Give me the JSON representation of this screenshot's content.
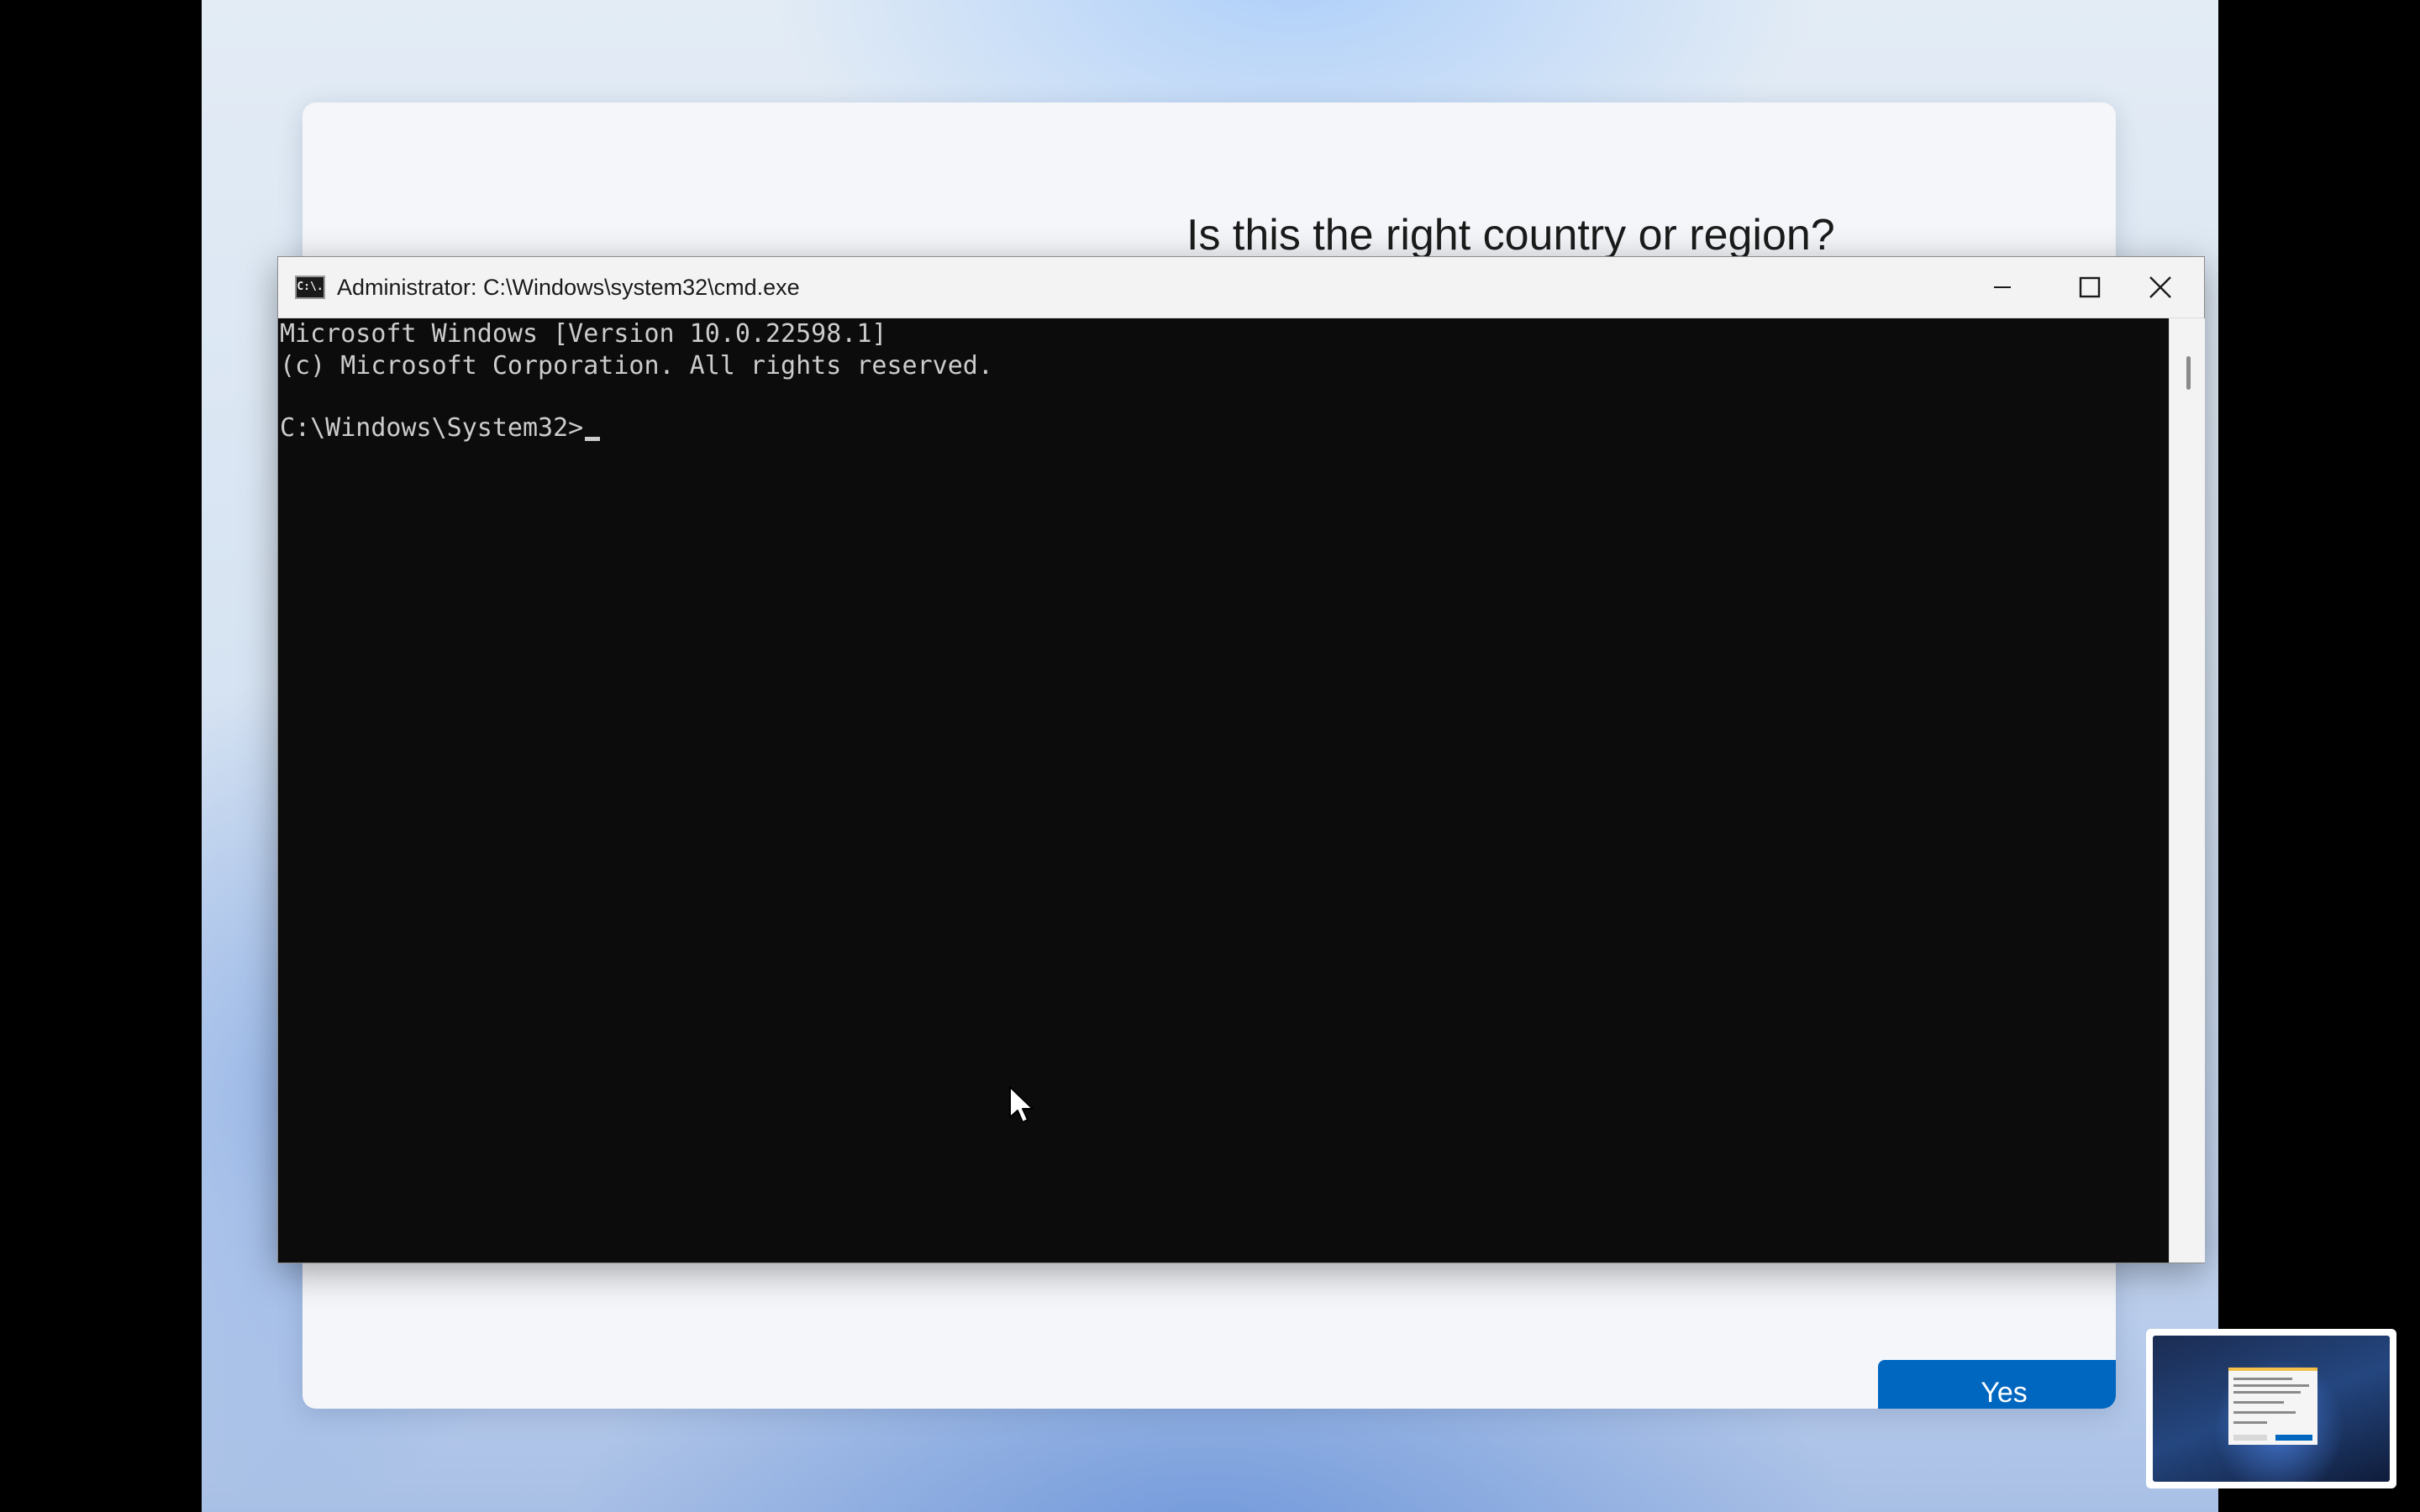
{
  "oobe": {
    "heading": "Is this the right country or region?",
    "yes_label": "Yes"
  },
  "cmd": {
    "title": "Administrator: C:\\Windows\\system32\\cmd.exe",
    "icon_text": "C:\\.",
    "lines": [
      "Microsoft Windows [Version 10.0.22598.1]",
      "(c) Microsoft Corporation. All rights reserved.",
      "C:\\Windows\\System32>"
    ]
  },
  "icons": {
    "window_icon": "cmd-icon",
    "minimize": "minimize-icon",
    "maximize": "maximize-icon",
    "close": "close-icon",
    "accessibility": "accessibility-icon",
    "volume": "volume-icon",
    "pointer": "mouse-pointer-icon"
  },
  "colors": {
    "console_bg": "#0c0c0c",
    "console_text": "#cccccc",
    "accent": "#0067c0"
  }
}
